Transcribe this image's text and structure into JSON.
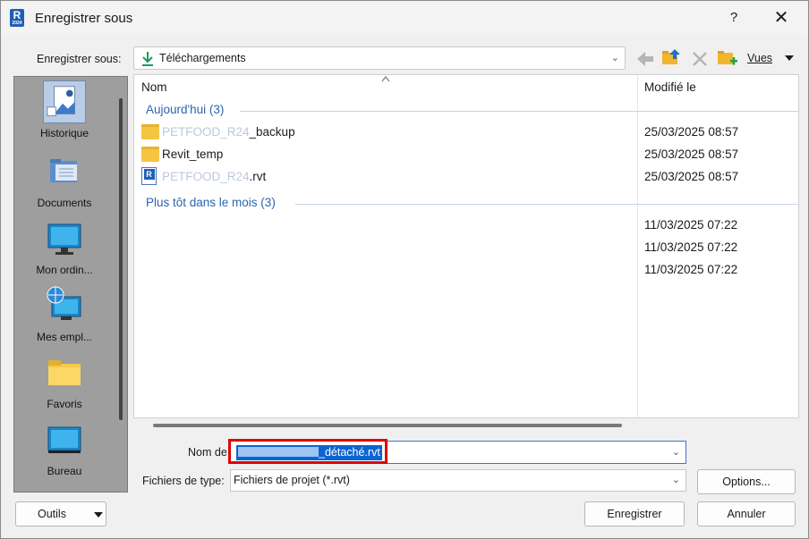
{
  "window": {
    "app_icon_letter": "R",
    "app_icon_sub": "2024",
    "title": "Enregistrer sous",
    "help": "?",
    "close": "✕"
  },
  "toolbar": {
    "save_in_label": "Enregistrer sous:",
    "location": "Téléchargements",
    "views_label": "Vues"
  },
  "places": [
    {
      "label": "Historique",
      "icon": "history-icon"
    },
    {
      "label": "Documents",
      "icon": "documents-icon"
    },
    {
      "label": "Mon ordin...",
      "icon": "computer-icon"
    },
    {
      "label": "Mes empl...",
      "icon": "network-places-icon"
    },
    {
      "label": "Favoris",
      "icon": "favorites-folder-icon"
    },
    {
      "label": "Bureau",
      "icon": "desktop-icon"
    }
  ],
  "file_list": {
    "col_name": "Nom",
    "col_modified": "Modifié le",
    "groups": [
      {
        "label": "Aujourd'hui (3)"
      },
      {
        "label": "Plus tôt dans le mois (3)"
      }
    ],
    "rows": [
      {
        "name_faded": "PETFOOD_R24",
        "name": "_backup",
        "date": "25/03/2025 08:57",
        "icon": "folder-icon"
      },
      {
        "name_faded": "",
        "name": "Revit_temp",
        "date": "25/03/2025 08:57",
        "icon": "folder-icon"
      },
      {
        "name_faded": "PETFOOD_R24",
        "name": ".rvt",
        "date": "25/03/2025 08:57",
        "icon": "rvt-file-icon"
      },
      {
        "name_faded": "",
        "name": "",
        "date": "11/03/2025 07:22",
        "icon": ""
      },
      {
        "name_faded": "",
        "name": "",
        "date": "11/03/2025 07:22",
        "icon": ""
      },
      {
        "name_faded": "",
        "name": "",
        "date": "11/03/2025 07:22",
        "icon": ""
      }
    ]
  },
  "form": {
    "filename_label": "Nom de",
    "filename_value_suffix": "_détaché.rvt",
    "filetype_label": "Fichiers de type:",
    "filetype_value": "Fichiers de projet  (*.rvt)"
  },
  "buttons": {
    "options": "Options...",
    "save": "Enregistrer",
    "cancel": "Annuler",
    "tools": "Outils"
  },
  "colors": {
    "group_header": "#2d63ae",
    "selection": "#0b64d2",
    "highlight_box": "#e00000"
  }
}
